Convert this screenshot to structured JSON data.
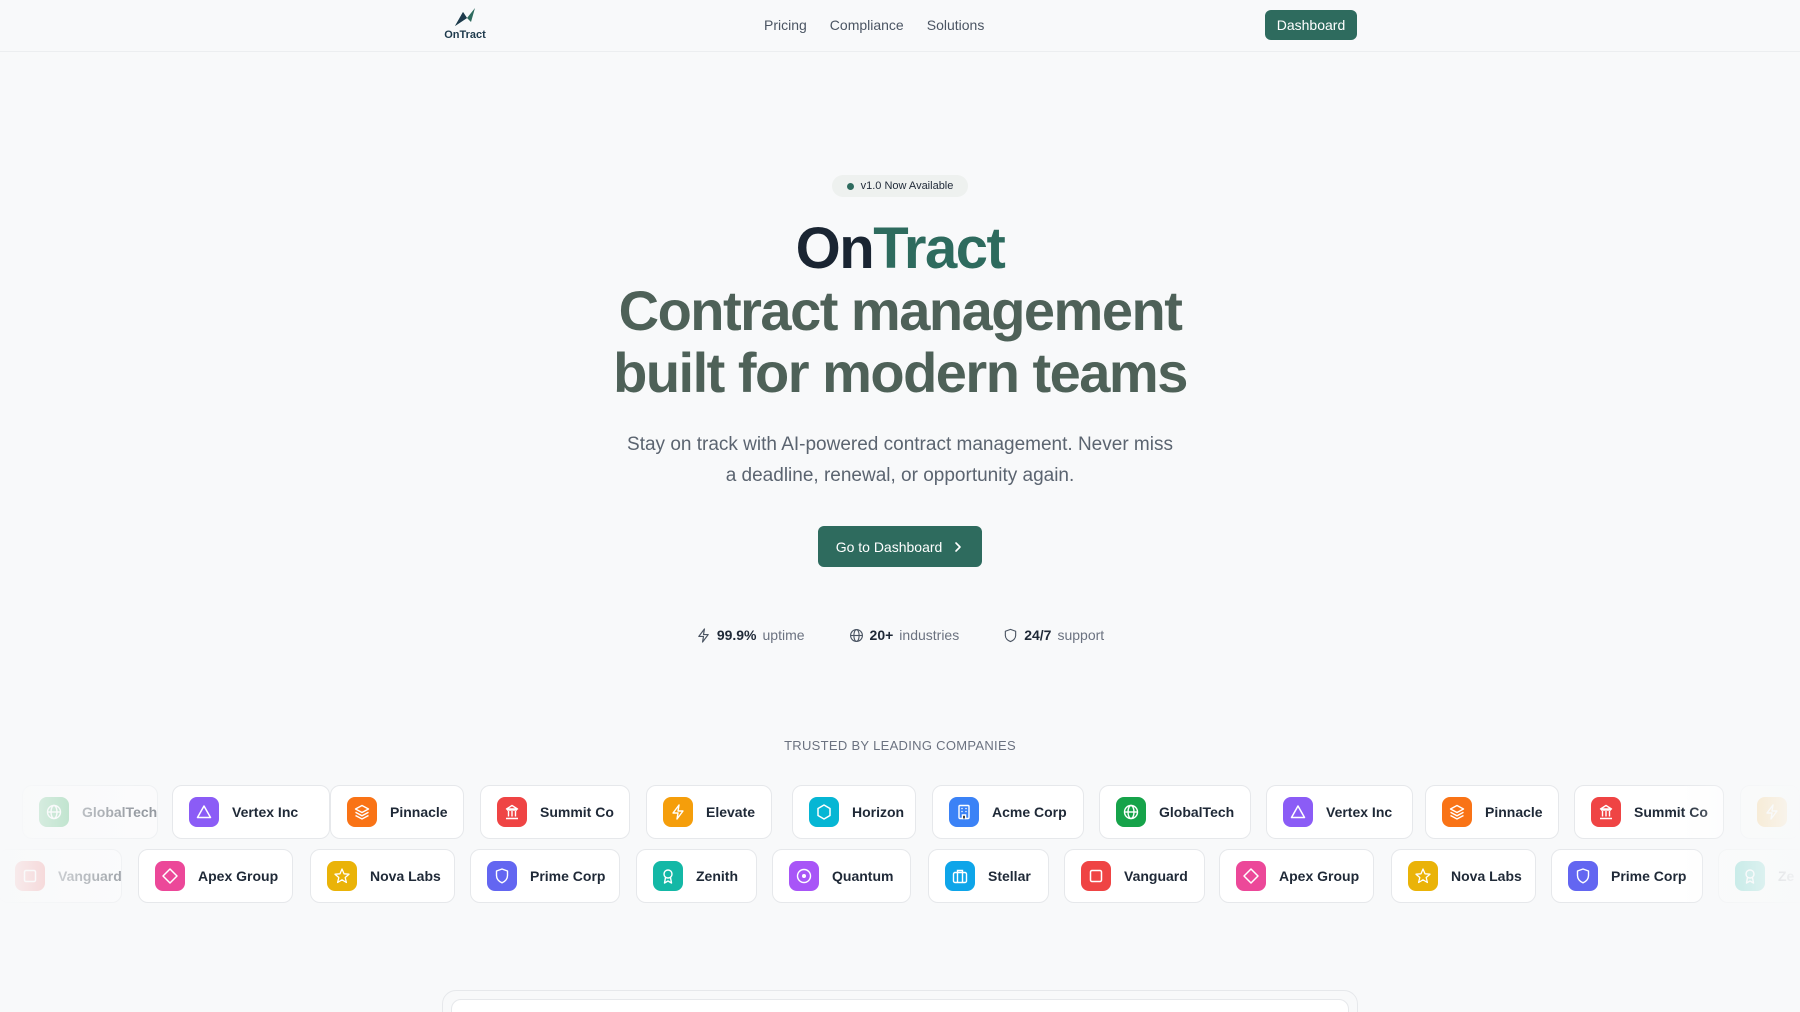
{
  "nav": {
    "logo_text": "OnTract",
    "links": [
      "Pricing",
      "Compliance",
      "Solutions"
    ],
    "dashboard_label": "Dashboard"
  },
  "hero": {
    "badge": "v1.0 Now Available",
    "title_on": "On",
    "title_tract": "Tract",
    "subtitle_line1": "Contract management",
    "subtitle_line2": "built for modern teams",
    "description": "Stay on track with AI-powered contract management. Never miss a deadline, renewal, or opportunity again.",
    "cta_label": "Go to Dashboard"
  },
  "stats": [
    {
      "value": "99.9%",
      "label": "uptime",
      "icon": "bolt-icon"
    },
    {
      "value": "20+",
      "label": "industries",
      "icon": "globe-icon"
    },
    {
      "value": "24/7",
      "label": "support",
      "icon": "shield-icon"
    }
  ],
  "trusted": {
    "label": "TRUSTED BY LEADING COMPANIES",
    "row1": [
      {
        "name": "GlobalTech",
        "icon": "globe",
        "color": "#16a34a"
      },
      {
        "name": "Vertex Inc",
        "icon": "triangle",
        "color": "#8b5cf6"
      },
      {
        "name": "Pinnacle",
        "icon": "layers",
        "color": "#f97316"
      },
      {
        "name": "Summit Co",
        "icon": "building",
        "color": "#ef4444"
      },
      {
        "name": "Elevate",
        "icon": "bolt",
        "color": "#f59e0b"
      },
      {
        "name": "Horizon",
        "icon": "hexagon",
        "color": "#06b6d4"
      },
      {
        "name": "Acme Corp",
        "icon": "office",
        "color": "#3b82f6"
      },
      {
        "name": "GlobalTech",
        "icon": "globe",
        "color": "#16a34a"
      },
      {
        "name": "Vertex Inc",
        "icon": "triangle",
        "color": "#8b5cf6"
      },
      {
        "name": "Pinnacle",
        "icon": "layers",
        "color": "#f97316"
      },
      {
        "name": "Summit Co",
        "icon": "building",
        "color": "#ef4444"
      },
      {
        "name": "",
        "icon": "bolt",
        "color": "#f59e0b"
      }
    ],
    "row2": [
      {
        "name": "Vanguard",
        "icon": "square",
        "color": "#ef4444"
      },
      {
        "name": "Apex Group",
        "icon": "diamond",
        "color": "#ec4899"
      },
      {
        "name": "Nova Labs",
        "icon": "star",
        "color": "#eab308"
      },
      {
        "name": "Prime Corp",
        "icon": "shield",
        "color": "#6366f1"
      },
      {
        "name": "Zenith",
        "icon": "award",
        "color": "#14b8a6"
      },
      {
        "name": "Quantum",
        "icon": "target",
        "color": "#a855f7"
      },
      {
        "name": "Stellar",
        "icon": "briefcase",
        "color": "#0ea5e9"
      },
      {
        "name": "Vanguard",
        "icon": "square",
        "color": "#ef4444"
      },
      {
        "name": "Apex Group",
        "icon": "diamond",
        "color": "#ec4899"
      },
      {
        "name": "Nova Labs",
        "icon": "star",
        "color": "#eab308"
      },
      {
        "name": "Prime Corp",
        "icon": "shield",
        "color": "#6366f1"
      },
      {
        "name": "Ze",
        "icon": "award",
        "color": "#14b8a6"
      }
    ]
  },
  "colors": {
    "brand": "#2e6b5e",
    "heading_dark": "#1a2532",
    "subtitle": "#4e6158"
  }
}
